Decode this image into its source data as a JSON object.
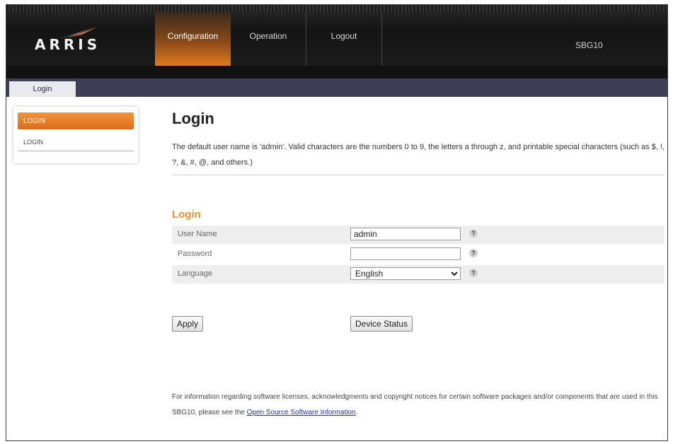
{
  "header": {
    "logo": "ARRIS",
    "nav": [
      {
        "label": "Configuration",
        "active": true
      },
      {
        "label": "Operation",
        "active": false
      },
      {
        "label": "Logout",
        "active": false
      }
    ],
    "device_name": "SBG10"
  },
  "tab": {
    "label": "Login"
  },
  "sidebar": {
    "heading": "LOGIN",
    "items": [
      {
        "label": "LOGIN"
      }
    ]
  },
  "main": {
    "title": "Login",
    "description": "The default user name is 'admin'. Valid characters are the numbers 0 to 9, the letters a through z, and printable special characters (such as $, !, ?, &, #, @, and others.)",
    "section_title": "Login",
    "fields": {
      "username": {
        "label": "User Name",
        "value": "admin"
      },
      "password": {
        "label": "Password",
        "value": ""
      },
      "language": {
        "label": "Language",
        "value": "English",
        "options": [
          "English"
        ]
      }
    },
    "help_glyph": "?",
    "apply_label": "Apply",
    "device_status_label": "Device Status",
    "footer_text": "For information regarding software licenses, acknowledgments and copyright notices for certain software packages and/or components that are used in this SBG10, please see the ",
    "footer_link": "Open Source Software Information",
    "footer_end": "."
  },
  "colors": {
    "accent_orange": "#e58f3a",
    "tab_bar": "#3c3f55",
    "header_dark": "#141414"
  }
}
